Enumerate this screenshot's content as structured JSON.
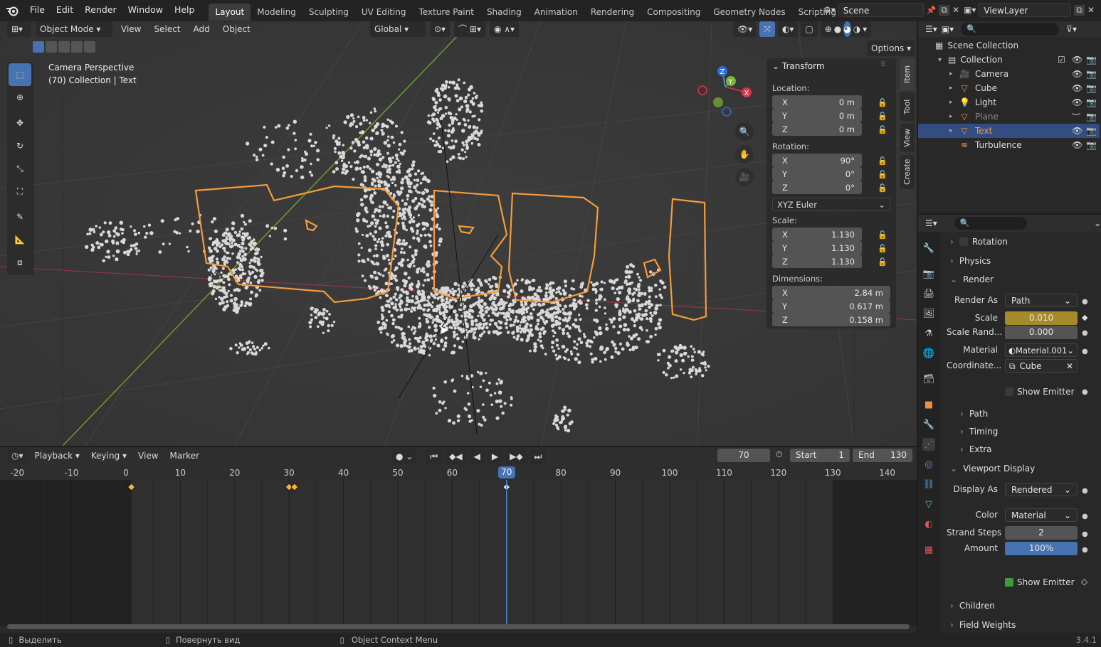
{
  "menus": [
    "File",
    "Edit",
    "Render",
    "Window",
    "Help"
  ],
  "workspaces": [
    "Layout",
    "Modeling",
    "Sculpting",
    "UV Editing",
    "Texture Paint",
    "Shading",
    "Animation",
    "Rendering",
    "Compositing",
    "Geometry Nodes",
    "Scripting"
  ],
  "active_workspace": "Layout",
  "scene": {
    "name": "Scene",
    "view_layer": "ViewLayer"
  },
  "viewport": {
    "mode": "Object Mode",
    "menus": [
      "View",
      "Select",
      "Add",
      "Object"
    ],
    "orientation": "Global",
    "options_label": "Options",
    "overlay_title": "Camera Perspective",
    "overlay_subtitle": "(70) Collection | Text",
    "gizmo_axes": [
      "X",
      "Y",
      "Z"
    ],
    "side_tabs": [
      "Item",
      "Tool",
      "View",
      "Create"
    ],
    "tool_icons": [
      "select-box-icon",
      "cursor-icon",
      "move-icon",
      "rotate-icon",
      "scale-icon",
      "transform-icon",
      "annotate-icon",
      "measure-icon",
      "add-cube-icon"
    ],
    "curve_text_glyphs": [
      "PIRA!"
    ]
  },
  "transform": {
    "title": "Transform",
    "location_label": "Location:",
    "location": [
      {
        "axis": "X",
        "value": "0 m"
      },
      {
        "axis": "Y",
        "value": "0 m"
      },
      {
        "axis": "Z",
        "value": "0 m"
      }
    ],
    "rotation_label": "Rotation:",
    "rotation": [
      {
        "axis": "X",
        "value": "90°"
      },
      {
        "axis": "Y",
        "value": "0°"
      },
      {
        "axis": "Z",
        "value": "0°"
      }
    ],
    "rotation_mode": "XYZ Euler",
    "scale_label": "Scale:",
    "scale": [
      {
        "axis": "X",
        "value": "1.130"
      },
      {
        "axis": "Y",
        "value": "1.130"
      },
      {
        "axis": "Z",
        "value": "1.130"
      }
    ],
    "dimensions_label": "Dimensions:",
    "dimensions": [
      {
        "axis": "X",
        "value": "2.84 m"
      },
      {
        "axis": "Y",
        "value": "0.617 m"
      },
      {
        "axis": "Z",
        "value": "0.158 m"
      }
    ]
  },
  "outliner": {
    "root": "Scene Collection",
    "collection": "Collection",
    "items": [
      {
        "name": "Camera",
        "icon": "camera-icon",
        "color": "#e7914a"
      },
      {
        "name": "Cube",
        "icon": "mesh-icon",
        "color": "#e7914a"
      },
      {
        "name": "Light",
        "icon": "light-icon",
        "color": "#e7914a"
      },
      {
        "name": "Plane",
        "icon": "mesh-icon",
        "color": "#e7914a"
      },
      {
        "name": "Text",
        "icon": "text-icon",
        "color": "#e7914a"
      },
      {
        "name": "Turbulence",
        "icon": "force-field-icon",
        "color": "#e7914a"
      }
    ]
  },
  "properties": {
    "sections": {
      "rotation": "Rotation",
      "physics": "Physics",
      "render": "Render",
      "path": "Path",
      "timing": "Timing",
      "extra": "Extra",
      "viewport_display": "Viewport Display",
      "children": "Children",
      "field_weights": "Field Weights"
    },
    "render_as_label": "Render As",
    "render_as": "Path",
    "scale_label": "Scale",
    "scale": "0.010",
    "scale_random_label": "Scale Rand...",
    "scale_random": "0.000",
    "material_label": "Material",
    "material": "Material.001",
    "coordinate_label": "Coordinate...",
    "coordinate": "Cube",
    "show_emitter_label": "Show Emitter",
    "display_as_label": "Display As",
    "display_as": "Rendered",
    "color_label": "Color",
    "color": "Material",
    "strand_steps_label": "Strand Steps",
    "strand_steps": "2",
    "amount_label": "Amount",
    "amount": "100%",
    "amount_fraction": 1.0,
    "show_emitter2_label": "Show Emitter"
  },
  "timeline": {
    "menus": [
      "Playback",
      "Keying",
      "View",
      "Marker"
    ],
    "current_frame": "70",
    "start_label": "Start",
    "start": "1",
    "end_label": "End",
    "end": "130",
    "ruler": [
      "-20",
      "-10",
      "0",
      "10",
      "20",
      "30",
      "40",
      "50",
      "60",
      "70",
      "80",
      "90",
      "100",
      "110",
      "120",
      "130",
      "140"
    ],
    "keyframes": [
      1,
      30,
      31,
      70
    ]
  },
  "statusbar": {
    "left": "Выделить",
    "middle": "Повернуть вид",
    "right": "Object Context Menu",
    "version": "3.4.1"
  },
  "colors": {
    "accent_blue": "#4772b3",
    "selection_orange": "#f39c3a",
    "keyframe": "#f5b43a",
    "playhead": "#4c86d9",
    "axis_red": "#b5384b",
    "axis_green": "#6f9a2e"
  }
}
